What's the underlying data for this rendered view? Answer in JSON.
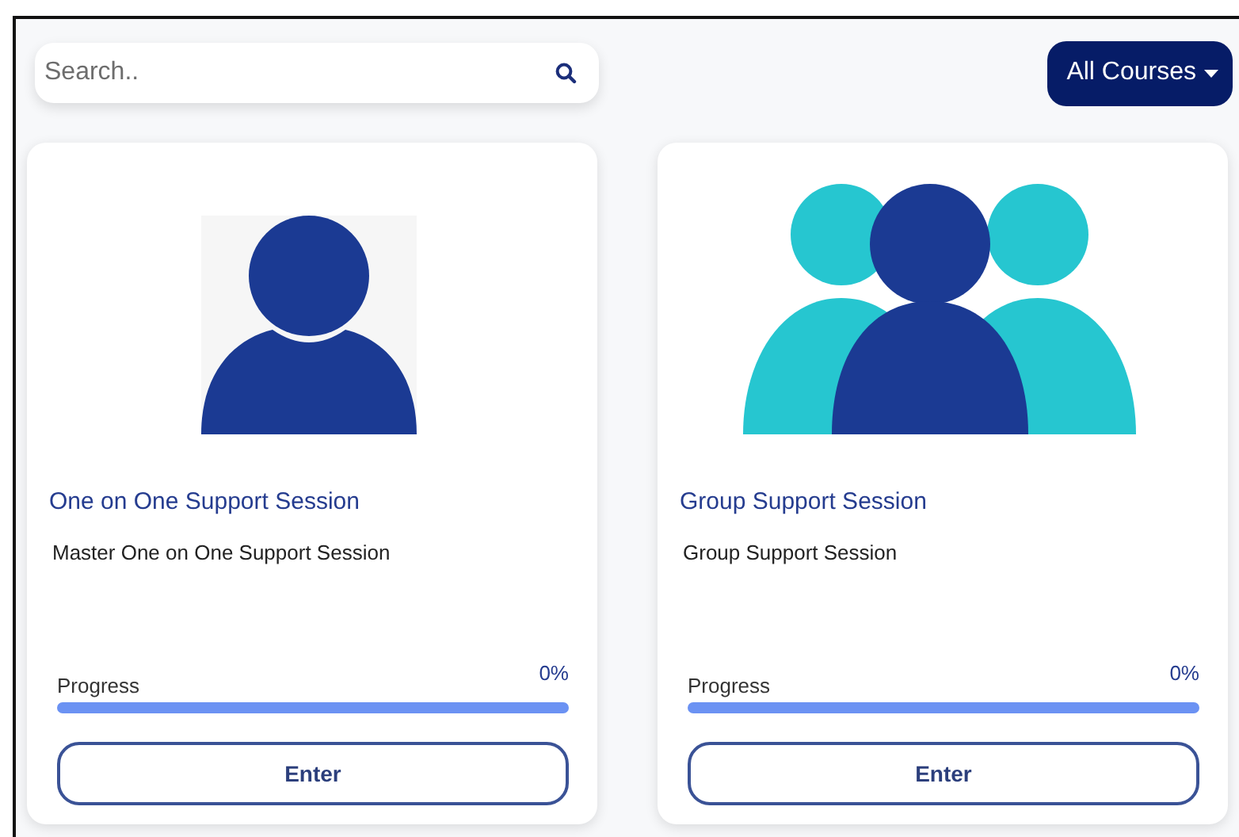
{
  "search": {
    "placeholder": "Search.."
  },
  "filter_button": {
    "label": "All Courses"
  },
  "courses": [
    {
      "kind": "single",
      "title": "One on One Support Session",
      "description": "Master One on One Support Session",
      "progress_label": "Progress",
      "progress_value": "0%",
      "level": 0,
      "button": "Enter"
    },
    {
      "kind": "group",
      "title": "Group Support Session",
      "description": "Group Support Session",
      "progress_label": "Progress",
      "progress_value": "0%",
      "level": 0,
      "button": "Enter"
    }
  ]
}
